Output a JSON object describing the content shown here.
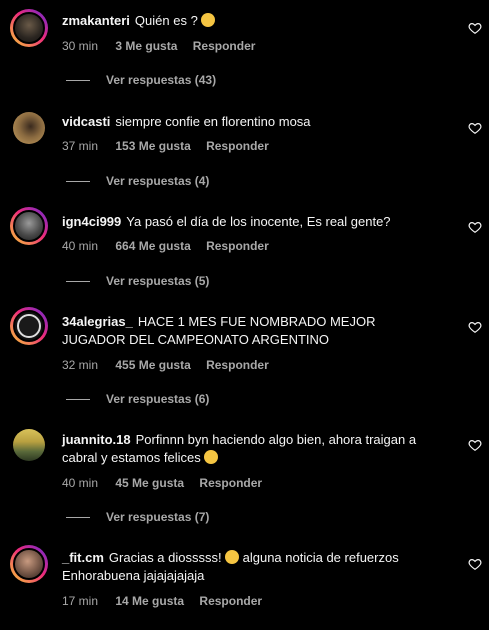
{
  "comments": [
    {
      "user": "zmakanteri",
      "text": "Quién es ?",
      "time": "30 min",
      "likes": "3 Me gusta",
      "reply": "Responder",
      "replies": "Ver respuestas (43)"
    },
    {
      "user": "vidcasti",
      "text": "siempre confie en florentino mosa",
      "time": "37 min",
      "likes": "153 Me gusta",
      "reply": "Responder",
      "replies": "Ver respuestas (4)"
    },
    {
      "user": "ign4ci999",
      "text": "Ya pasó el día de los inocente, Es real gente?",
      "time": "40 min",
      "likes": "664 Me gusta",
      "reply": "Responder",
      "replies": "Ver respuestas (5)"
    },
    {
      "user": "34alegrias_",
      "text": "HACE 1 MES FUE NOMBRADO MEJOR JUGADOR DEL CAMPEONATO ARGENTINO",
      "time": "32 min",
      "likes": "455 Me gusta",
      "reply": "Responder",
      "replies": "Ver respuestas (6)"
    },
    {
      "user": "juannito.18",
      "text": "Porfinnn byn haciendo algo bien, ahora traigan a cabral y estamos felices",
      "time": "40 min",
      "likes": "45 Me gusta",
      "reply": "Responder",
      "replies": "Ver respuestas (7)"
    },
    {
      "user": "_fit.cm",
      "text": "Gracias a diosssss!",
      "text2": "alguna noticia de refuerzos Enhorabuena jajajajajaja",
      "time": "17 min",
      "likes": "14 Me gusta",
      "reply": "Responder"
    }
  ],
  "icons": {
    "like": "heart-outline-icon",
    "emoji": "emoji-icon"
  },
  "colors": {
    "background": "#000000",
    "text": "#f5f5f5",
    "muted": "#a8a8a8",
    "ring_start": "#f9ce34",
    "ring_mid": "#ee2a7b",
    "ring_end": "#6228d7"
  }
}
